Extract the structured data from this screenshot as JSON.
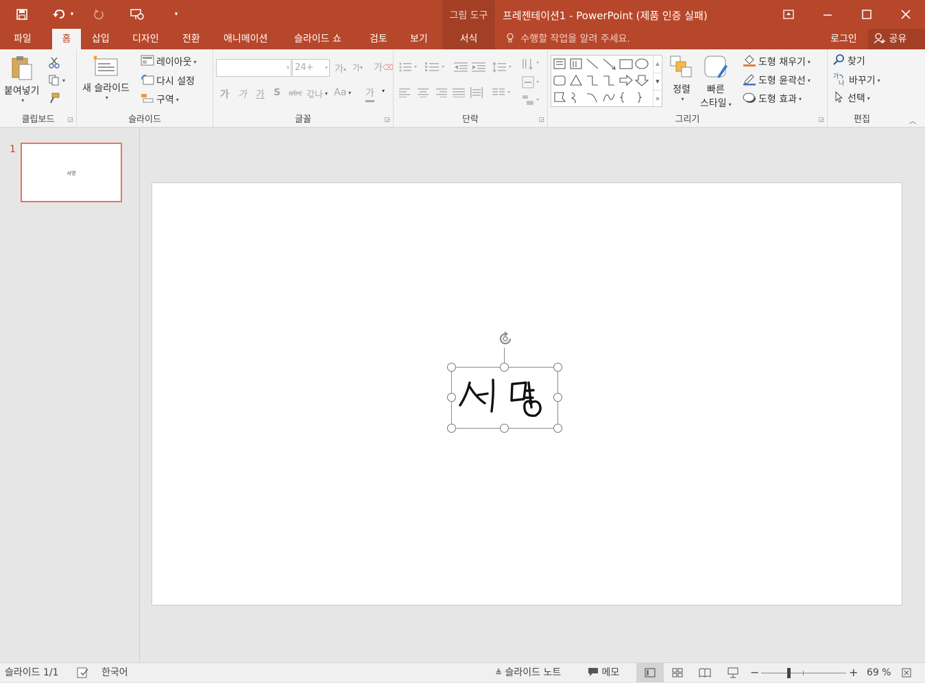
{
  "app": {
    "window_title": "프레젠테이션1 - PowerPoint (제품 인증 실패)",
    "contextual_tab_group": "그림 도구",
    "colors": {
      "accent": "#b7472a",
      "accent_dark": "#a33f25",
      "selection": "#e9735a"
    }
  },
  "quick_access": [
    {
      "name": "save-icon",
      "glyph": "💾"
    },
    {
      "name": "undo-icon",
      "glyph": "↶"
    },
    {
      "name": "redo-icon",
      "glyph": "↻"
    },
    {
      "name": "presenter-icon",
      "glyph": "▭"
    },
    {
      "name": "customize-icon",
      "glyph": "▾"
    }
  ],
  "window_controls": {
    "ribbon_display": "⤒",
    "minimize": "—",
    "maximize": "☐",
    "close": "✕"
  },
  "tabs": [
    "파일",
    "홈",
    "삽입",
    "디자인",
    "전환",
    "애니메이션",
    "슬라이드 쇼",
    "검토",
    "보기",
    "서식"
  ],
  "active_tab": "홈",
  "tell_me": "수행할 작업을 알려 주세요.",
  "login": "로그인",
  "share": "공유",
  "ribbon": {
    "clipboard": {
      "label": "클립보드",
      "paste": "붙여넣기"
    },
    "slides": {
      "label": "슬라이드",
      "new_slide": "새 슬라이드",
      "layout": "레이아웃",
      "reset": "다시 설정",
      "section": "구역"
    },
    "font": {
      "label": "글꼴",
      "font_name": "",
      "font_size": "24+",
      "bold": "가",
      "italic": "가",
      "underline": "가",
      "shadow": "S",
      "strike": "abc",
      "spacing": "갃나",
      "case": "Aa",
      "color": "가",
      "grow": "가",
      "shrink": "가",
      "clear": "가"
    },
    "paragraph": {
      "label": "단락"
    },
    "drawing": {
      "label": "그리기",
      "arrange": "정렬",
      "quick_styles_1": "빠른",
      "quick_styles_2": "스타일",
      "shape_fill": "도형 채우기",
      "shape_outline": "도형 윤곽선",
      "shape_effects": "도형 효과"
    },
    "editing": {
      "label": "편집",
      "find": "찾기",
      "replace": "바꾸기",
      "select": "선택"
    }
  },
  "thumbnail": {
    "number": "1",
    "text": "서명"
  },
  "slide": {
    "signature_text": "서명"
  },
  "status": {
    "slide_counter": "슬라이드 1/1",
    "language": "한국어",
    "notes": "슬라이드 노트",
    "comments": "메모",
    "zoom": "69 %",
    "zoom_fraction": 0.69
  }
}
